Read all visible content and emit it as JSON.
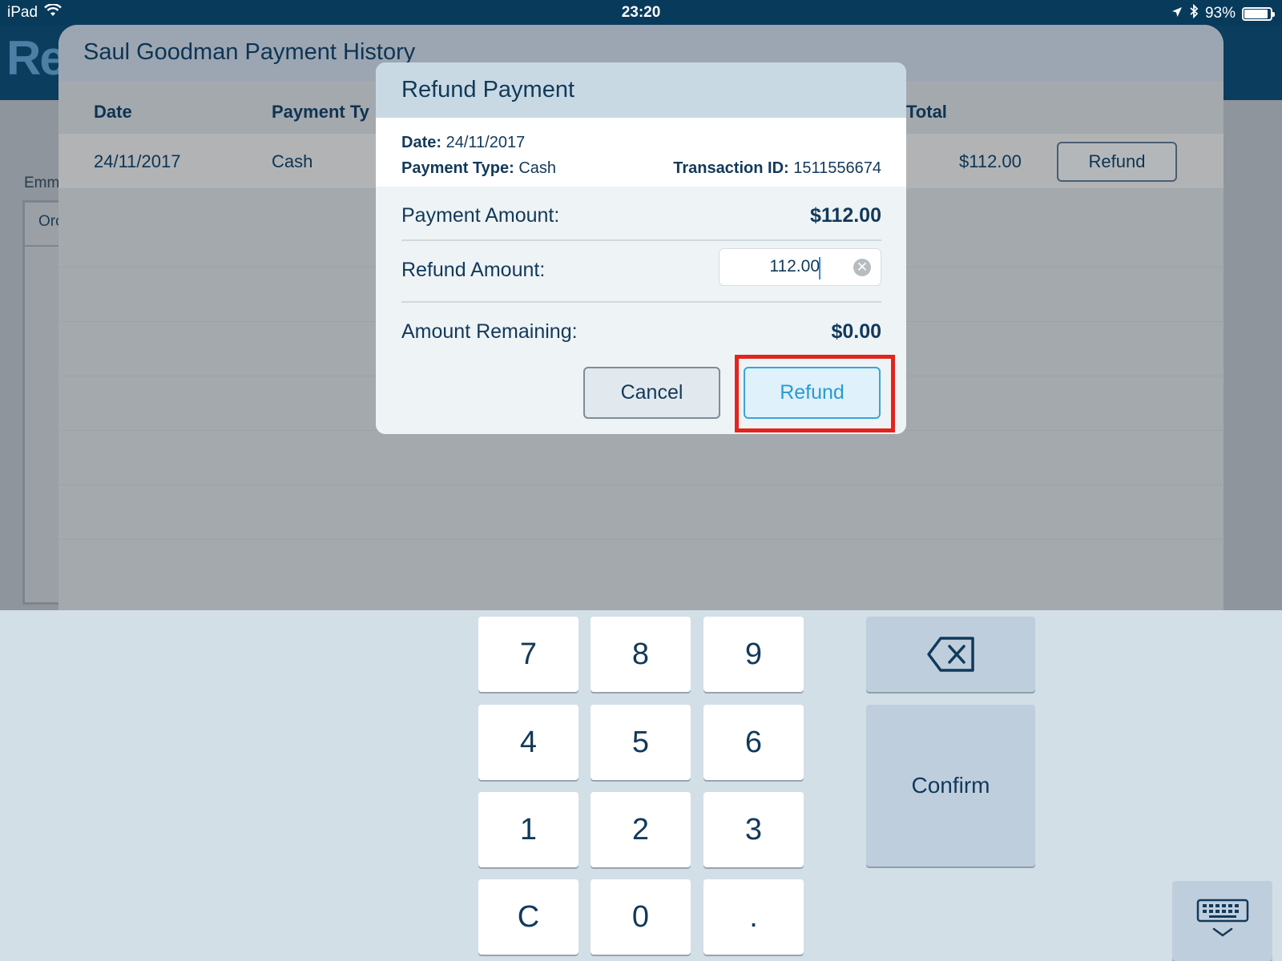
{
  "status_bar": {
    "device": "iPad",
    "time": "23:20",
    "battery": "93%",
    "battery_level": 0.93
  },
  "background": {
    "logo_fragment": "Re",
    "side_label": "Emm",
    "side_table_header": "Orc"
  },
  "history": {
    "title": "Saul Goodman Payment History",
    "columns": {
      "date": "Date",
      "payment_type": "Payment Ty",
      "total": "Total"
    },
    "row": {
      "date": "24/11/2017",
      "payment_type": "Cash",
      "total": "$112.00",
      "action": "Refund"
    }
  },
  "modal": {
    "title": "Refund Payment",
    "info": {
      "date_label": "Date:",
      "date_value": "24/11/2017",
      "type_label": "Payment Type:",
      "type_value": "Cash",
      "txn_label": "Transaction ID:",
      "txn_value": "1511556674"
    },
    "payment_amount_label": "Payment Amount:",
    "payment_amount_value": "$112.00",
    "refund_amount_label": "Refund Amount:",
    "refund_amount_value": "112.00",
    "remaining_label": "Amount Remaining:",
    "remaining_value": "$0.00",
    "cancel_label": "Cancel",
    "refund_label": "Refund"
  },
  "keypad": {
    "keys": [
      "7",
      "8",
      "9",
      "4",
      "5",
      "6",
      "1",
      "2",
      "3",
      "C",
      "0",
      "."
    ],
    "confirm_label": "Confirm",
    "backspace_icon": "backspace-icon",
    "hide_icon": "keyboard-hide-icon"
  },
  "colors": {
    "highlight": "#e3241c",
    "accent": "#2b9ad3",
    "header": "#083a5b"
  }
}
